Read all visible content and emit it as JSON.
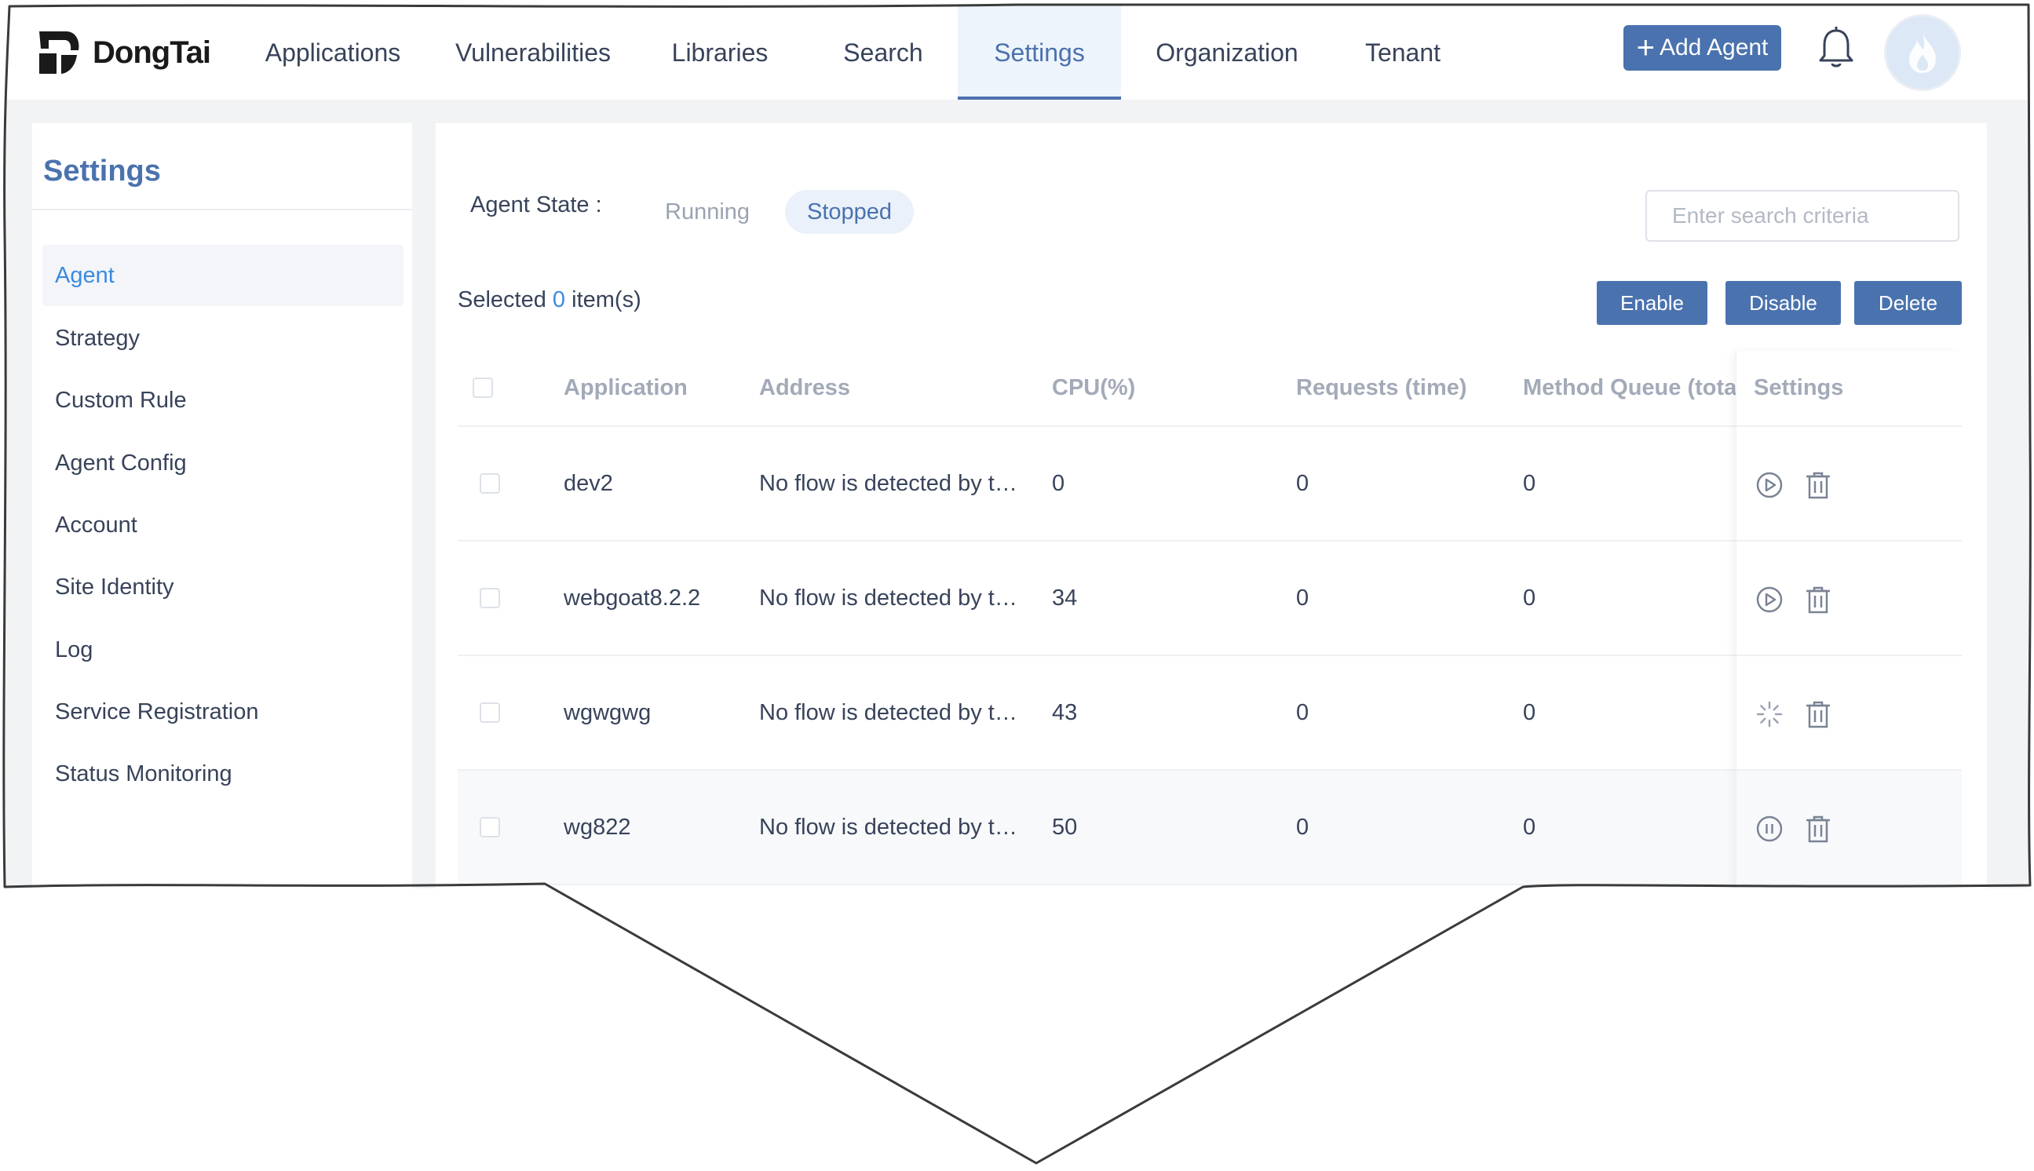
{
  "brand": {
    "name": "DongTai"
  },
  "nav": {
    "items": [
      {
        "label": "Applications"
      },
      {
        "label": "Vulnerabilities"
      },
      {
        "label": "Libraries"
      },
      {
        "label": "Search"
      },
      {
        "label": "Settings",
        "active": true
      },
      {
        "label": "Organization"
      },
      {
        "label": "Tenant"
      }
    ],
    "add_agent_label": "Add Agent",
    "add_agent_icon": "plus-icon",
    "bell_icon": "bell-icon",
    "avatar_icon": "flame-avatar-icon"
  },
  "sidebar": {
    "title": "Settings",
    "items": [
      {
        "label": "Agent",
        "active": true
      },
      {
        "label": "Strategy"
      },
      {
        "label": "Custom Rule"
      },
      {
        "label": "Agent Config"
      },
      {
        "label": "Account"
      },
      {
        "label": "Site Identity"
      },
      {
        "label": "Log"
      },
      {
        "label": "Service Registration"
      },
      {
        "label": "Status Monitoring"
      }
    ]
  },
  "filters": {
    "state_label": "Agent State :",
    "running_label": "Running",
    "stopped_label": "Stopped",
    "active_state": "Stopped"
  },
  "search": {
    "placeholder": "Enter search criteria"
  },
  "selection": {
    "prefix": "Selected",
    "count": "0",
    "suffix": "item(s)"
  },
  "actions": {
    "enable": "Enable",
    "disable": "Disable",
    "delete": "Delete"
  },
  "table": {
    "columns": [
      "Application",
      "Address",
      "CPU(%)",
      "Requests (time)",
      "Method Queue (tota",
      "Settings"
    ],
    "rows": [
      {
        "application": "dev2",
        "address": "No flow is detected by t…",
        "cpu": "0",
        "requests": "0",
        "queue": "0",
        "action_icon": "play-icon",
        "delete_icon": "trash-icon"
      },
      {
        "application": "webgoat8.2.2",
        "address": "No flow is detected by t…",
        "cpu": "34",
        "requests": "0",
        "queue": "0",
        "action_icon": "play-icon",
        "delete_icon": "trash-icon"
      },
      {
        "application": "wgwgwg",
        "address": "No flow is detected by t…",
        "cpu": "43",
        "requests": "0",
        "queue": "0",
        "action_icon": "loading-spinner-icon",
        "delete_icon": "trash-icon"
      },
      {
        "application": "wg822",
        "address": "No flow is detected by t…",
        "cpu": "50",
        "requests": "0",
        "queue": "0",
        "action_icon": "pause-icon",
        "delete_icon": "trash-icon"
      }
    ]
  },
  "colors": {
    "primary": "#4a72ae",
    "link": "#3b8be0",
    "background": "#f2f3f5",
    "text": "#38435a"
  }
}
